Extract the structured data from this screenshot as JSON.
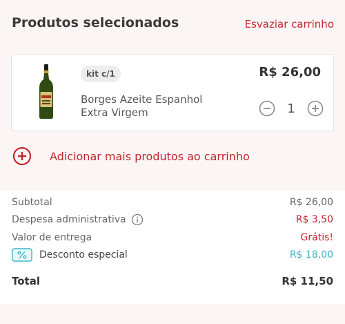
{
  "header": {
    "title": "Produtos selecionados",
    "clear_label": "Esvaziar carrinho"
  },
  "product": {
    "kit_label": "kit c/1",
    "price": "R$ 26,00",
    "name_line1": "Borges Azeite Espanhol",
    "name_line2": "Extra Virgem",
    "quantity": "1"
  },
  "add_more_label": "Adicionar mais produtos ao carrinho",
  "summary": {
    "subtotal_label": "Subtotal",
    "subtotal_value": "R$ 26,00",
    "fee_label": "Despesa administrativa",
    "fee_value": "R$ 3,50",
    "delivery_label": "Valor de entrega",
    "delivery_value": "Grátis!",
    "discount_label": "Desconto especial",
    "discount_value": "R$ 18,00",
    "total_label": "Total",
    "total_value": "R$ 11,50"
  },
  "colors": {
    "accent": "#c0262d",
    "discount": "#3fb3c5",
    "background_tint": "#fbf5f5"
  },
  "icons": {
    "product_image": "olive-oil-bottle-icon",
    "decrease": "minus-circle-icon",
    "increase": "plus-circle-icon",
    "add_more": "plus-circle-icon",
    "info": "info-icon",
    "discount": "percent-tag-icon"
  }
}
